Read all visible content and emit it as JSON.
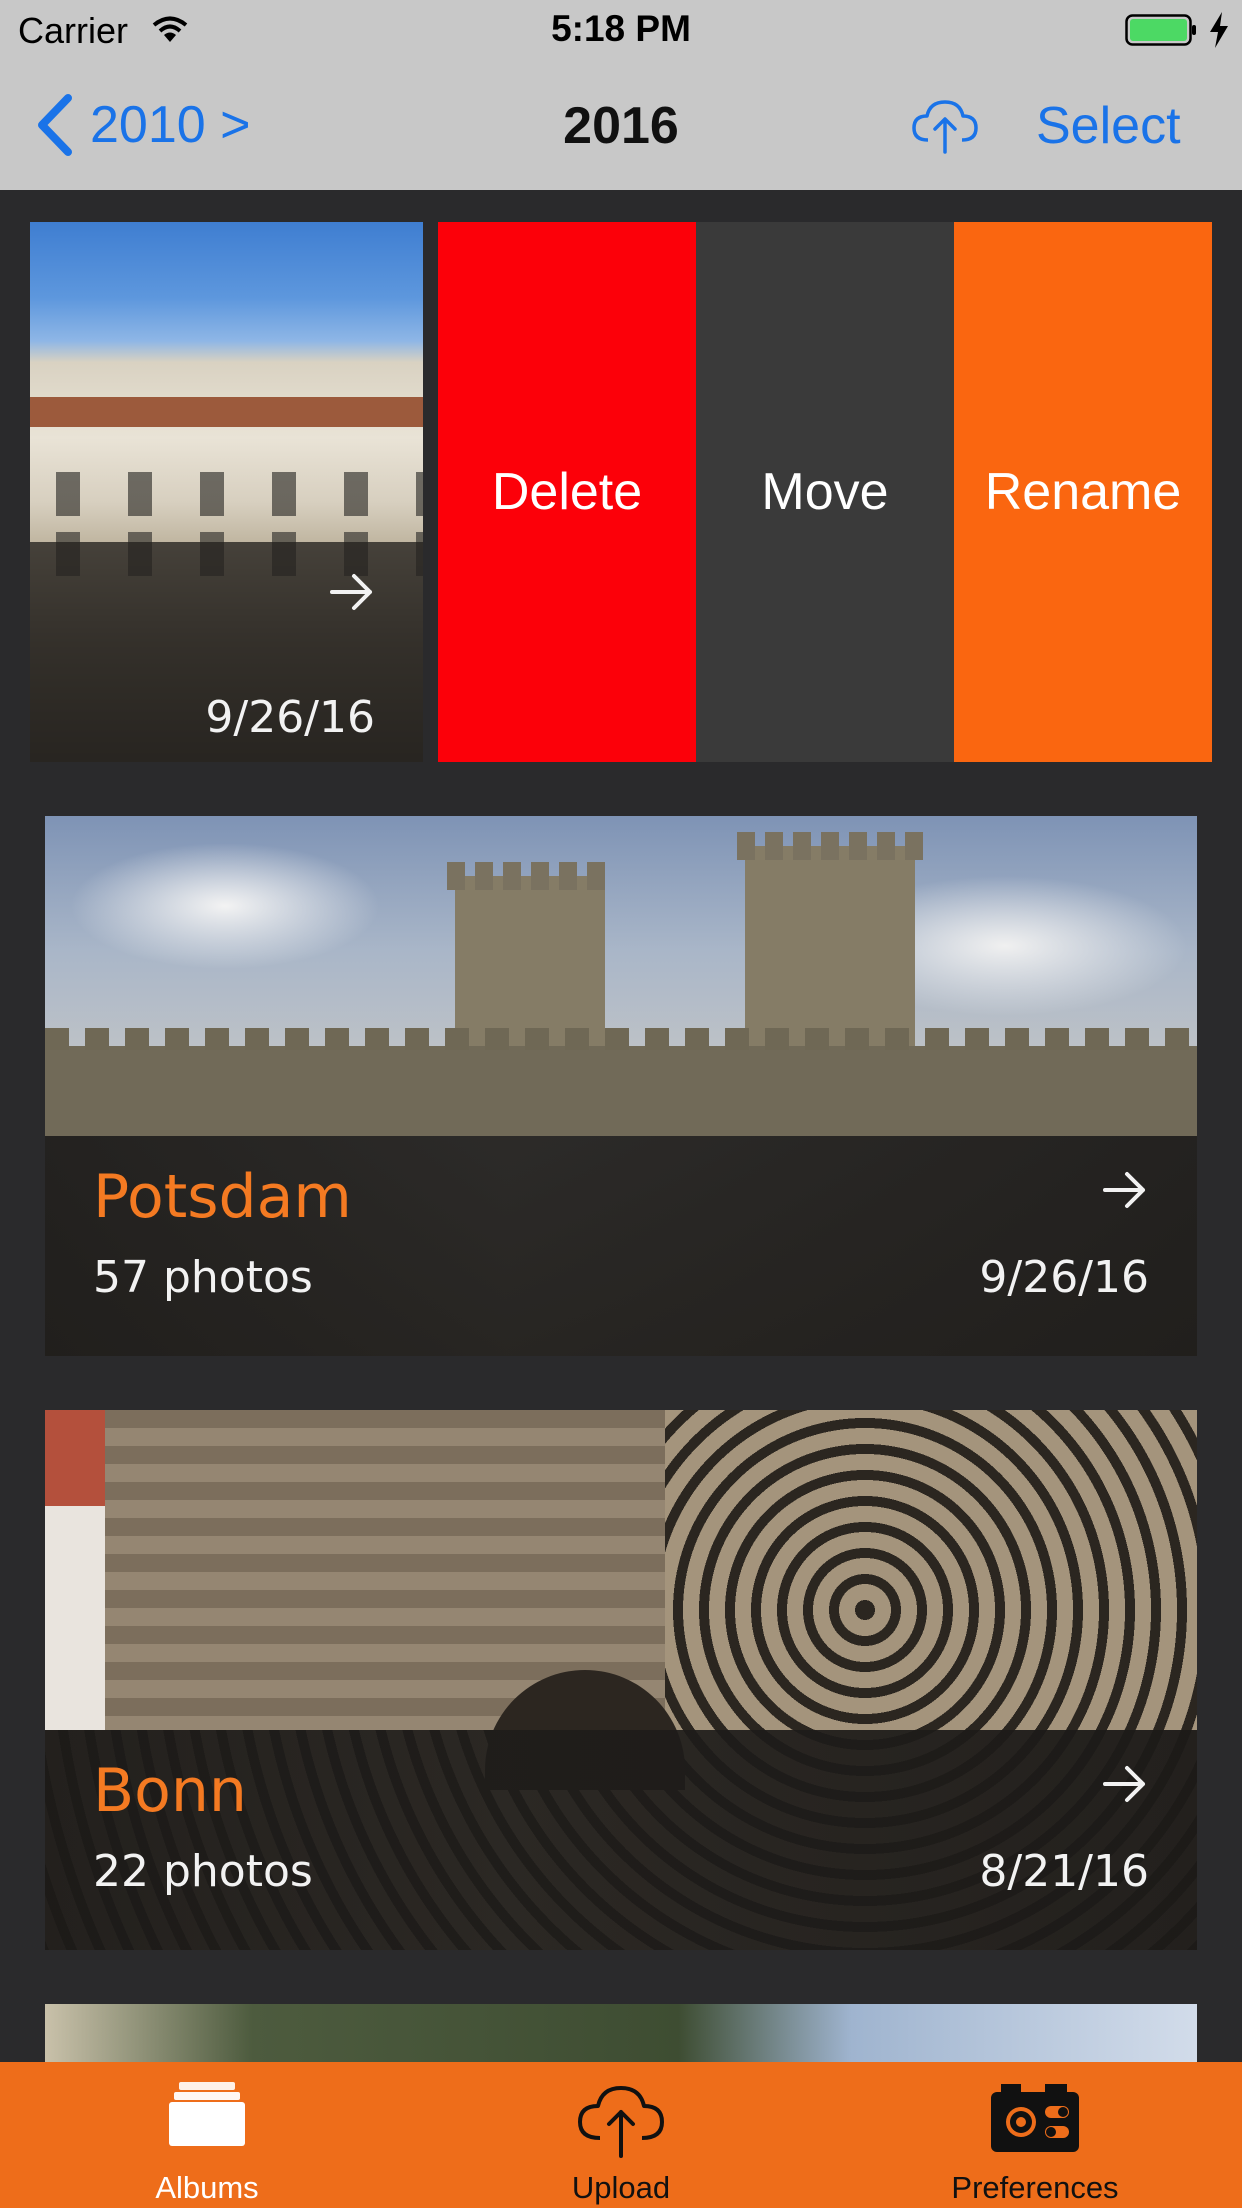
{
  "status_bar": {
    "carrier": "Carrier",
    "time": "5:18 PM",
    "icons": [
      "wifi-icon",
      "battery-icon",
      "charging-icon"
    ],
    "battery_color": "#4cd964"
  },
  "nav_bar": {
    "back_label": "2010 >",
    "title": "2016",
    "select_label": "Select",
    "icons": [
      "chevron-left-icon",
      "cloud-upload-icon"
    ],
    "tint_color": "#1a73e8"
  },
  "swiped_album": {
    "date": "9/26/16",
    "actions": {
      "delete": "Delete",
      "move": "Move",
      "rename": "Rename"
    },
    "action_colors": {
      "delete": "#fc0009",
      "move": "#3a3a3a",
      "rename": "#fa6610"
    }
  },
  "albums": [
    {
      "name": "Potsdam",
      "count": "57 photos",
      "date": "9/26/16"
    },
    {
      "name": "Bonn",
      "count": "22 photos",
      "date": "8/21/16"
    }
  ],
  "accent_color": "#f47a22",
  "tab_bar": {
    "background": "#ee6d1a",
    "tabs": [
      {
        "label": "Albums",
        "icon": "albums-stack-icon",
        "selected": true
      },
      {
        "label": "Upload",
        "icon": "cloud-upload-icon",
        "selected": false
      },
      {
        "label": "Preferences",
        "icon": "preferences-gear-icon",
        "selected": false
      }
    ]
  }
}
